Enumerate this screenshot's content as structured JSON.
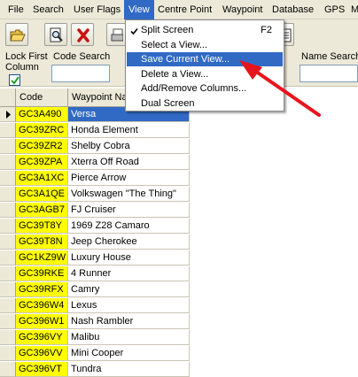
{
  "menubar": {
    "items": [
      "File",
      "Search",
      "User Flags",
      "View",
      "Centre Point",
      "Waypoint",
      "Database",
      "GPS",
      "M"
    ]
  },
  "search": {
    "lock_first_line1": "Lock First",
    "lock_first_line2": "Column",
    "lock_first_checked": true,
    "code_search_label": "Code Search",
    "code_search_value": "",
    "name_search_label": "Name Search",
    "name_search_value": ""
  },
  "grid": {
    "columns": [
      "Code",
      "Waypoint Na"
    ],
    "rows": [
      {
        "code": "GC3A490",
        "name": "Versa"
      },
      {
        "code": "GC39ZRC",
        "name": "Honda Element"
      },
      {
        "code": "GC39ZR2",
        "name": "Shelby Cobra"
      },
      {
        "code": "GC39ZPA",
        "name": "Xterra Off Road"
      },
      {
        "code": "GC3A1XC",
        "name": "Pierce Arrow"
      },
      {
        "code": "GC3A1QE",
        "name": "Volkswagen \"The Thing\""
      },
      {
        "code": "GC3AGB7",
        "name": "FJ Cruiser"
      },
      {
        "code": "GC39T8Y",
        "name": "1969 Z28 Camaro"
      },
      {
        "code": "GC39T8N",
        "name": "Jeep Cherokee"
      },
      {
        "code": "GC1KZ9W",
        "name": "Luxury House"
      },
      {
        "code": "GC39RKE",
        "name": "4 Runner"
      },
      {
        "code": "GC39RFX",
        "name": "Camry"
      },
      {
        "code": "GC396W4",
        "name": "Lexus"
      },
      {
        "code": "GC396W1",
        "name": "Nash Rambler"
      },
      {
        "code": "GC396VY",
        "name": "Malibu"
      },
      {
        "code": "GC396VV",
        "name": "Mini Cooper"
      },
      {
        "code": "GC396VT",
        "name": "Tundra"
      }
    ],
    "selected_index": 0
  },
  "view_menu": {
    "items": [
      {
        "label": "Split Screen",
        "shortcut": "F2",
        "checked": true
      },
      {
        "label": "Select a View...",
        "shortcut": "",
        "checked": false
      },
      {
        "label": "Save Current View...",
        "shortcut": "",
        "checked": false
      },
      {
        "label": "Delete a View...",
        "shortcut": "",
        "checked": false
      },
      {
        "label": "Add/Remove Columns...",
        "shortcut": "",
        "checked": false
      },
      {
        "label": "Dual Screen",
        "shortcut": "",
        "checked": false
      }
    ],
    "highlighted_index": 2
  },
  "colors": {
    "highlight": "#316ac5",
    "code_cell": "#ffff00",
    "annotation_arrow": "#e8141c"
  }
}
